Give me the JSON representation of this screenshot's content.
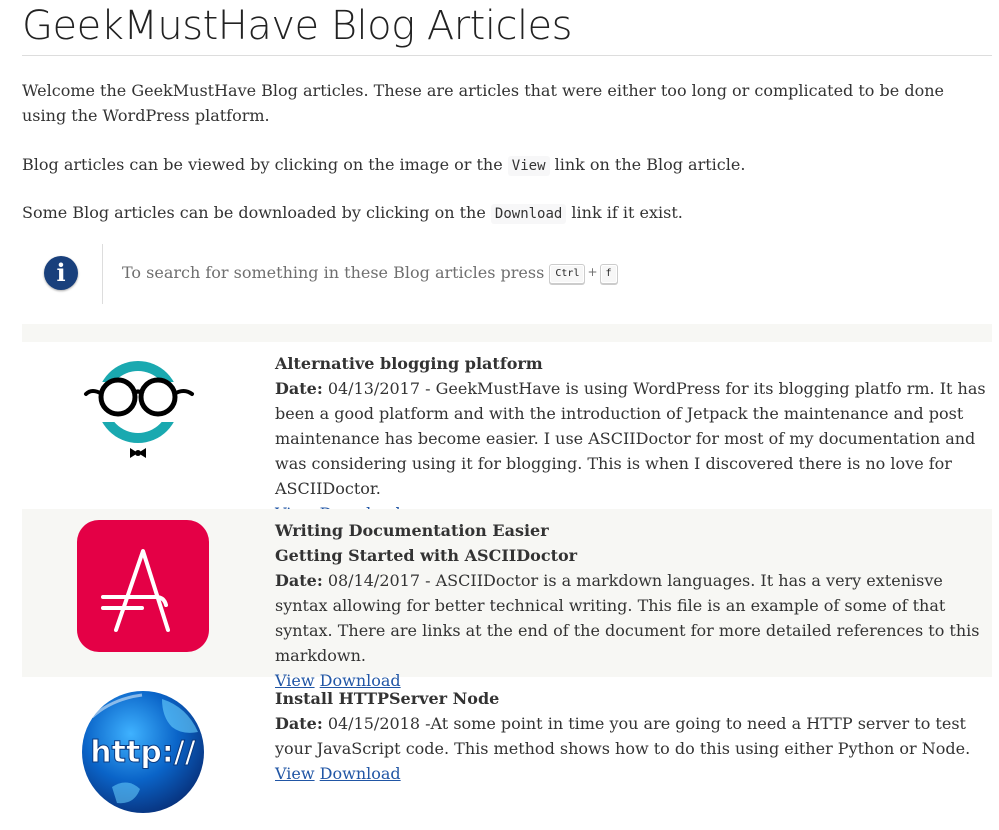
{
  "page": {
    "title": "GeekMustHave Blog Articles"
  },
  "intro": {
    "p1": "Welcome the GeekMustHave Blog articles. These are articles that were either too long or complicated to be done using the WordPress platform.",
    "p2_before": "Blog articles can be viewed by clicking on the image or the ",
    "p2_code": "View",
    "p2_after": " link on the Blog article.",
    "p3_before": "Some Blog articles can be downloaded by clicking on the ",
    "p3_code": "Download",
    "p3_after": " link if it exist."
  },
  "tip": {
    "icon": "info-icon",
    "text": "To search for something in these Blog articles press",
    "key1": "Ctrl",
    "plus": "+",
    "key2": "f"
  },
  "articles": [
    {
      "title": "Alternative blogging platform",
      "subtitle": "",
      "date_label": "Date:",
      "date": "04/13/2017",
      "summary": " - GeekMustHave is using WordPress for its blogging platfo rm. It has been a good platform and with the introduction of Jetpack the maintenance and post maintenance has become easier. I use ASCIIDoctor for most of my documentation and was considering using it for blogging. This is when I discovered there is no love for ASCIIDoctor.",
      "view_label": "View",
      "download_label": "Download",
      "image": "geek-glasses-logo"
    },
    {
      "title": "Writing Documentation Easier",
      "subtitle": "Getting Started with ASCIIDoctor",
      "date_label": "Date:",
      "date": "08/14/2017",
      "summary": " - ASCIIDoctor is a markdown languages. It has a very extenisve syntax allowing for better technical writing. This file is an example of some of that syntax. There are links at the end of the document for more detailed references to this markdown.",
      "view_label": "View",
      "download_label": "Download",
      "image": "asciidoctor-logo"
    },
    {
      "title": "Install HTTPServer Node",
      "subtitle": "",
      "date_label": "Date:",
      "date": "04/15/2018",
      "summary": " -At some point in time you are going to need a HTTP server to test your JavaScript code. This method shows how to do this using either Python or Node.",
      "view_label": "View",
      "download_label": "Download",
      "image": "http-globe-logo",
      "image_text": "http://"
    }
  ],
  "colors": {
    "link": "#2156a5",
    "alt_row": "#f7f7f4",
    "info_icon": "#19407c",
    "asciidoctor_red": "#e40046",
    "geek_teal": "#1aa9b0"
  }
}
